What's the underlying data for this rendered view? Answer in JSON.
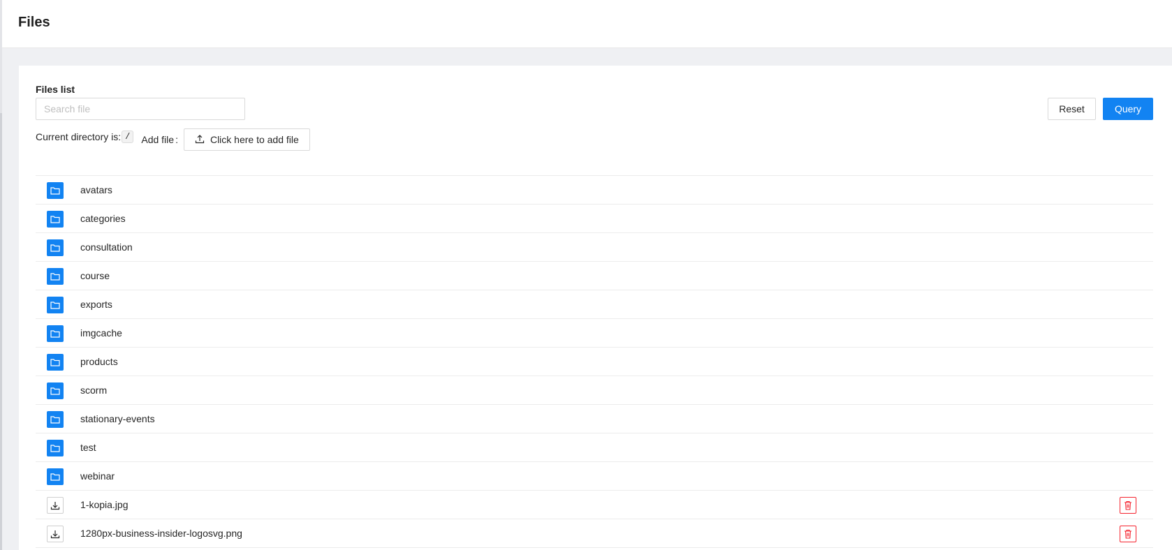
{
  "header": {
    "title": "Files"
  },
  "files": {
    "list_label": "Files list",
    "search_placeholder": "Search file",
    "search_value": "",
    "reset_label": "Reset",
    "query_label": "Query",
    "current_dir_label": "Current directory is:",
    "current_dir": "/",
    "add_file_label": "Add file",
    "add_file_colon": ":",
    "upload_label": "Click here to add file"
  },
  "entries": [
    {
      "type": "folder",
      "name": "avatars",
      "icon": "folder-icon"
    },
    {
      "type": "folder",
      "name": "categories",
      "icon": "folder-icon"
    },
    {
      "type": "folder",
      "name": "consultation",
      "icon": "folder-icon"
    },
    {
      "type": "folder",
      "name": "course",
      "icon": "folder-icon"
    },
    {
      "type": "folder",
      "name": "exports",
      "icon": "folder-icon"
    },
    {
      "type": "folder",
      "name": "imgcache",
      "icon": "folder-icon"
    },
    {
      "type": "folder",
      "name": "products",
      "icon": "folder-icon"
    },
    {
      "type": "folder",
      "name": "scorm",
      "icon": "folder-icon"
    },
    {
      "type": "folder",
      "name": "stationary-events",
      "icon": "folder-icon"
    },
    {
      "type": "folder",
      "name": "test",
      "icon": "folder-icon"
    },
    {
      "type": "folder",
      "name": "webinar",
      "icon": "folder-icon"
    },
    {
      "type": "file",
      "name": "1-kopia.jpg",
      "icon": "download-icon"
    },
    {
      "type": "file",
      "name": "1280px-business-insider-logosvg.png",
      "icon": "download-icon"
    }
  ],
  "colors": {
    "accent": "#1283f2",
    "danger": "#f5222d",
    "background": "#eff0f3"
  }
}
